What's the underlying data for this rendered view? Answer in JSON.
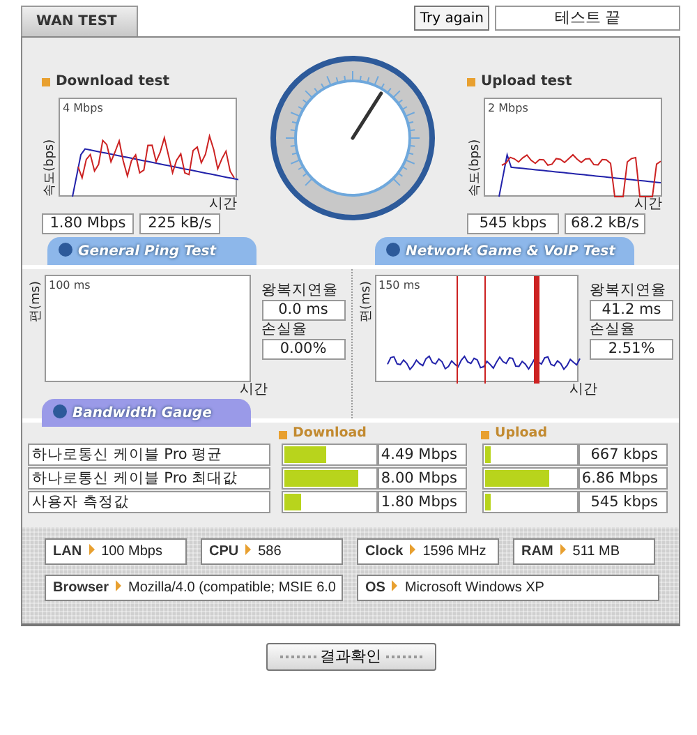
{
  "tabs": [
    {
      "label": "WAN TEST",
      "selected": true
    }
  ],
  "try_again_button": "Try again",
  "status": "테스트 끝",
  "download": {
    "title": "Download test",
    "axis_label": "속도(bps)",
    "max_label": "4 Mbps",
    "x_label": "시간",
    "rate": "1.80 Mbps",
    "bytes": "225 kB/s"
  },
  "upload": {
    "title": "Upload test",
    "axis_label": "속도(bps)",
    "max_label": "2 Mbps",
    "x_label": "시간",
    "rate": "545 kbps",
    "bytes": "68.2 kB/s"
  },
  "ping_headers": [
    "General Ping Test",
    "Network Game & VoIP Test"
  ],
  "ping_panels": [
    {
      "kind": "blank",
      "axis_label": "편(ms)",
      "max_label": "100 ms",
      "x_label": "시간",
      "latency_label": "왕복지연율",
      "latency": "0.0 ms",
      "loss_label": "손실율",
      "loss": "0.00%"
    },
    {
      "kind": "trace",
      "axis_label": "편(ms)",
      "max_label": "150 ms",
      "x_label": "시간",
      "latency_label": "왕복지연율",
      "latency": "41.2 ms",
      "loss_label": "손실율",
      "loss": "2.51%"
    }
  ],
  "bandwidth": {
    "header": "Bandwidth Gauge",
    "download_label": "Download",
    "upload_label": "Upload",
    "rows": [
      {
        "name": "하나로통신 케이블 Pro 평균",
        "download": {
          "level": 0.46,
          "value": "4.49 Mbps"
        },
        "upload": {
          "level": 0.06,
          "value": "667 kbps"
        }
      },
      {
        "name": "하나로통신 케이블 Pro 최대값",
        "download": {
          "level": 0.82,
          "value": "8.00 Mbps"
        },
        "upload": {
          "level": 0.7,
          "value": "6.86 Mbps"
        }
      },
      {
        "name": "사용자 측정값",
        "download": {
          "level": 0.18,
          "value": "1.80 Mbps"
        },
        "upload": {
          "level": 0.06,
          "value": "545 kbps"
        }
      }
    ]
  },
  "system_info": [
    [
      {
        "label": "LAN",
        "value": "100 Mbps"
      },
      {
        "label": "CPU",
        "value": "586"
      },
      {
        "label": "Clock",
        "value": "1596 MHz"
      },
      {
        "label": "RAM",
        "value": "511 MB"
      }
    ],
    [
      {
        "label": "Browser",
        "value": "Mozilla/4.0 (compatible; MSIE 6.0"
      },
      {
        "label": "OS",
        "value": "Microsoft Windows XP"
      }
    ]
  ],
  "result_button": "결과확인"
}
